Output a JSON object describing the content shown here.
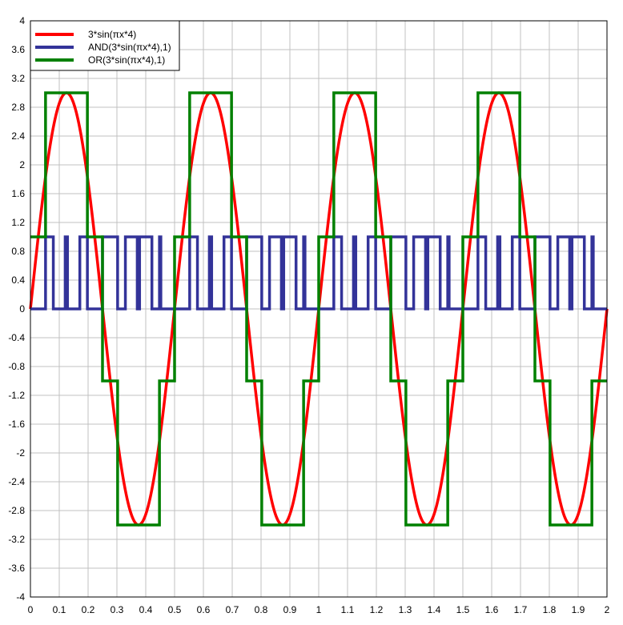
{
  "chart_data": {
    "type": "line",
    "title": "",
    "xlabel": "",
    "ylabel": "",
    "xlim": [
      0,
      2
    ],
    "ylim": [
      -4,
      4
    ],
    "grid": true,
    "legend_position": "top-left",
    "x_ticks": [
      "0",
      "0.1",
      "0.2",
      "0.3",
      "0.4",
      "0.5",
      "0.6",
      "0.7",
      "0.8",
      "0.9",
      "1",
      "1.1",
      "1.2",
      "1.3",
      "1.4",
      "1.5",
      "1.6",
      "1.7",
      "1.8",
      "1.9",
      "2"
    ],
    "y_ticks": [
      "4",
      "3.6",
      "3.2",
      "2.8",
      "2.4",
      "2",
      "1.6",
      "1.2",
      "0.8",
      "0.4",
      "0",
      "-0.4",
      "-0.8",
      "-1.2",
      "-1.6",
      "-2",
      "-2.4",
      "-2.8",
      "-3.2",
      "-3.6",
      "-4"
    ],
    "series": [
      {
        "name": "3*sin(πx*4)",
        "color": "#ff0000",
        "kind": "function",
        "formula": "3*sin(pi*x*4)"
      },
      {
        "name": "AND(3*sin(πx*4),1)",
        "color": "#333399",
        "kind": "step",
        "points": [
          [
            0,
            0
          ],
          [
            0.0524,
            0
          ],
          [
            0.0524,
            1
          ],
          [
            0.0794,
            1
          ],
          [
            0.0794,
            0
          ],
          [
            0.1206,
            0
          ],
          [
            0.1206,
            1
          ],
          [
            0.1286,
            1
          ],
          [
            0.1286,
            0
          ],
          [
            0.1714,
            0
          ],
          [
            0.1714,
            1
          ],
          [
            0.1976,
            1
          ],
          [
            0.1976,
            0
          ],
          [
            0.25,
            0
          ],
          [
            0.25,
            1
          ],
          [
            0.3024,
            1
          ],
          [
            0.3024,
            0
          ],
          [
            0.3294,
            0
          ],
          [
            0.3294,
            1
          ],
          [
            0.3706,
            1
          ],
          [
            0.3706,
            0
          ],
          [
            0.3786,
            0
          ],
          [
            0.3786,
            1
          ],
          [
            0.4214,
            1
          ],
          [
            0.4214,
            0
          ],
          [
            0.4476,
            0
          ],
          [
            0.4476,
            1
          ],
          [
            0.4524,
            1
          ],
          [
            0.4524,
            0
          ],
          [
            0.5524,
            0
          ],
          [
            0.5524,
            1
          ],
          [
            0.5794,
            1
          ],
          [
            0.5794,
            0
          ],
          [
            0.6206,
            0
          ],
          [
            0.6206,
            1
          ],
          [
            0.6286,
            1
          ],
          [
            0.6286,
            0
          ],
          [
            0.6714,
            0
          ],
          [
            0.6714,
            1
          ],
          [
            0.6976,
            1
          ],
          [
            0.6976,
            0
          ],
          [
            0.75,
            0
          ],
          [
            0.75,
            1
          ],
          [
            0.8024,
            1
          ],
          [
            0.8024,
            0
          ],
          [
            0.8294,
            0
          ],
          [
            0.8294,
            1
          ],
          [
            0.8706,
            1
          ],
          [
            0.8706,
            0
          ],
          [
            0.8786,
            0
          ],
          [
            0.8786,
            1
          ],
          [
            0.9214,
            1
          ],
          [
            0.9214,
            0
          ],
          [
            0.9476,
            0
          ],
          [
            0.9476,
            1
          ],
          [
            0.9524,
            1
          ],
          [
            0.9524,
            0
          ],
          [
            1.0524,
            0
          ],
          [
            1.0524,
            1
          ],
          [
            1.0794,
            1
          ],
          [
            1.0794,
            0
          ],
          [
            1.1206,
            0
          ],
          [
            1.1206,
            1
          ],
          [
            1.1286,
            1
          ],
          [
            1.1286,
            0
          ],
          [
            1.1714,
            0
          ],
          [
            1.1714,
            1
          ],
          [
            1.1976,
            1
          ],
          [
            1.1976,
            0
          ],
          [
            1.25,
            0
          ],
          [
            1.25,
            1
          ],
          [
            1.3024,
            1
          ],
          [
            1.3024,
            0
          ],
          [
            1.3294,
            0
          ],
          [
            1.3294,
            1
          ],
          [
            1.3706,
            1
          ],
          [
            1.3706,
            0
          ],
          [
            1.3786,
            0
          ],
          [
            1.3786,
            1
          ],
          [
            1.4214,
            1
          ],
          [
            1.4214,
            0
          ],
          [
            1.4476,
            0
          ],
          [
            1.4476,
            1
          ],
          [
            1.4524,
            1
          ],
          [
            1.4524,
            0
          ],
          [
            1.5524,
            0
          ],
          [
            1.5524,
            1
          ],
          [
            1.5794,
            1
          ],
          [
            1.5794,
            0
          ],
          [
            1.6206,
            0
          ],
          [
            1.6206,
            1
          ],
          [
            1.6286,
            1
          ],
          [
            1.6286,
            0
          ],
          [
            1.6714,
            0
          ],
          [
            1.6714,
            1
          ],
          [
            1.6976,
            1
          ],
          [
            1.6976,
            0
          ],
          [
            1.75,
            0
          ],
          [
            1.75,
            1
          ],
          [
            1.8024,
            1
          ],
          [
            1.8024,
            0
          ],
          [
            1.8294,
            0
          ],
          [
            1.8294,
            1
          ],
          [
            1.8706,
            1
          ],
          [
            1.8706,
            0
          ],
          [
            1.8786,
            0
          ],
          [
            1.8786,
            1
          ],
          [
            1.9214,
            1
          ],
          [
            1.9214,
            0
          ],
          [
            1.9476,
            0
          ],
          [
            1.9476,
            1
          ],
          [
            1.9524,
            1
          ],
          [
            1.9524,
            0
          ],
          [
            2,
            0
          ]
        ]
      },
      {
        "name": "OR(3*sin(πx*4),1)",
        "color": "#008000",
        "kind": "step",
        "points": [
          [
            0,
            1
          ],
          [
            0.0524,
            1
          ],
          [
            0.0524,
            3
          ],
          [
            0.1976,
            3
          ],
          [
            0.1976,
            1
          ],
          [
            0.25,
            1
          ],
          [
            0.25,
            -1
          ],
          [
            0.3024,
            -1
          ],
          [
            0.3024,
            -3
          ],
          [
            0.4476,
            -3
          ],
          [
            0.4476,
            -1
          ],
          [
            0.5,
            -1
          ],
          [
            0.5,
            1
          ],
          [
            0.5524,
            1
          ],
          [
            0.5524,
            3
          ],
          [
            0.6976,
            3
          ],
          [
            0.6976,
            1
          ],
          [
            0.75,
            1
          ],
          [
            0.75,
            -1
          ],
          [
            0.8024,
            -1
          ],
          [
            0.8024,
            -3
          ],
          [
            0.9476,
            -3
          ],
          [
            0.9476,
            -1
          ],
          [
            1.0,
            -1
          ],
          [
            1.0,
            1
          ],
          [
            1.0524,
            1
          ],
          [
            1.0524,
            3
          ],
          [
            1.1976,
            3
          ],
          [
            1.1976,
            1
          ],
          [
            1.25,
            1
          ],
          [
            1.25,
            -1
          ],
          [
            1.3024,
            -1
          ],
          [
            1.3024,
            -3
          ],
          [
            1.4476,
            -3
          ],
          [
            1.4476,
            -1
          ],
          [
            1.5,
            -1
          ],
          [
            1.5,
            1
          ],
          [
            1.5524,
            1
          ],
          [
            1.5524,
            3
          ],
          [
            1.6976,
            3
          ],
          [
            1.6976,
            1
          ],
          [
            1.75,
            1
          ],
          [
            1.75,
            -1
          ],
          [
            1.8024,
            -1
          ],
          [
            1.8024,
            -3
          ],
          [
            1.9476,
            -3
          ],
          [
            1.9476,
            -1
          ],
          [
            2,
            -1
          ]
        ]
      }
    ]
  }
}
